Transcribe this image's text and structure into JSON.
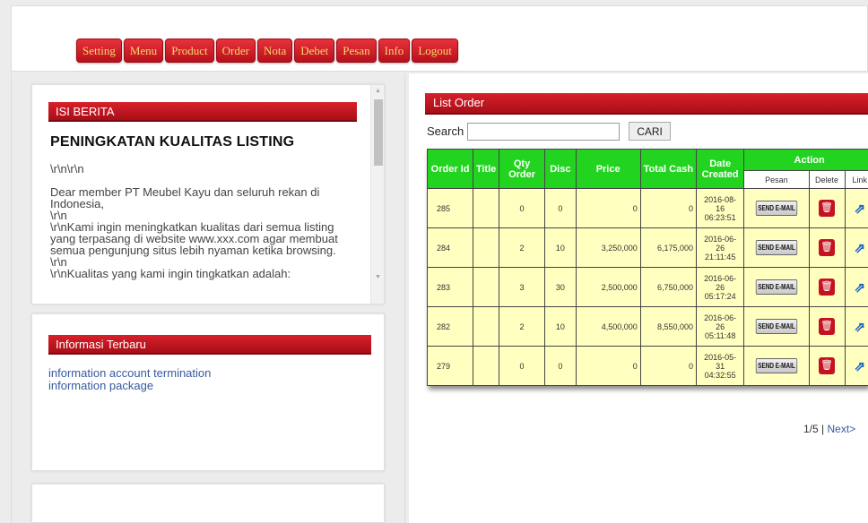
{
  "menu": [
    "Setting",
    "Menu",
    "Product",
    "Order",
    "Nota",
    "Debet",
    "Pesan",
    "Info",
    "Logout"
  ],
  "news": {
    "header": "ISI BERITA",
    "title": "PENINGKATAN KUALITAS LISTING",
    "paragraphs": [
      "\\r\\n\\r\\n",
      "Dear member PT Meubel Kayu dan seluruh rekan di Indonesia,",
      "\\r\\n",
      "\\r\\nKami ingin meningkatkan kualitas dari semua listing yang terpasang di website www.xxx.com agar membuat semua pengunjung situs lebih nyaman ketika browsing.",
      "\\r\\n",
      "\\r\\nKualitas yang kami ingin tingkatkan adalah:"
    ]
  },
  "info": {
    "header": "Informasi Terbaru",
    "links": [
      "information account termination",
      "information package"
    ]
  },
  "orders": {
    "header": "List Order",
    "search_label": "Search",
    "search_value": "",
    "search_button": "CARI",
    "columns": {
      "order_id": "Order Id",
      "title": "Title",
      "qty": "Qty Order",
      "disc": "Disc",
      "price": "Price",
      "total": "Total Cash",
      "date": "Date Created",
      "action": "Action",
      "pesan": "Pesan",
      "delete": "Delete",
      "link": "Link"
    },
    "rows": [
      {
        "id": "285",
        "title": "",
        "qty": "0",
        "disc": "0",
        "price": "0",
        "total": "0",
        "date": [
          "2016-08-",
          "16",
          "06:23:51"
        ],
        "email": "SEND E-MAIL"
      },
      {
        "id": "284",
        "title": "",
        "qty": "2",
        "disc": "10",
        "price": "3,250,000",
        "total": "6,175,000",
        "date": [
          "2016-06-",
          "26",
          "21:11:45"
        ],
        "email": "SEND E-MAIL"
      },
      {
        "id": "283",
        "title": "",
        "qty": "3",
        "disc": "30",
        "price": "2,500,000",
        "total": "6,750,000",
        "date": [
          "2016-06-",
          "26",
          "05:17:24"
        ],
        "email": "SEND E-MAIL"
      },
      {
        "id": "282",
        "title": "",
        "qty": "2",
        "disc": "10",
        "price": "4,500,000",
        "total": "8,550,000",
        "date": [
          "2016-06-",
          "26",
          "05:11:48"
        ],
        "email": "SEND E-MAIL"
      },
      {
        "id": "279",
        "title": "",
        "qty": "0",
        "disc": "0",
        "price": "0",
        "total": "0",
        "date": [
          "2016-05-",
          "31",
          "04:32:55"
        ],
        "email": "SEND E-MAIL"
      }
    ],
    "pager": {
      "page": "1/5",
      "sep": "|",
      "next": "Next>"
    }
  },
  "icons": {
    "delete": "trash-icon",
    "link": "external-link-icon"
  },
  "colors": {
    "menu": "#c8141e",
    "menu_text": "#f5d86a",
    "table_header": "#22d41f",
    "row_bg": "#ffffc0",
    "link": "#375a9e"
  }
}
